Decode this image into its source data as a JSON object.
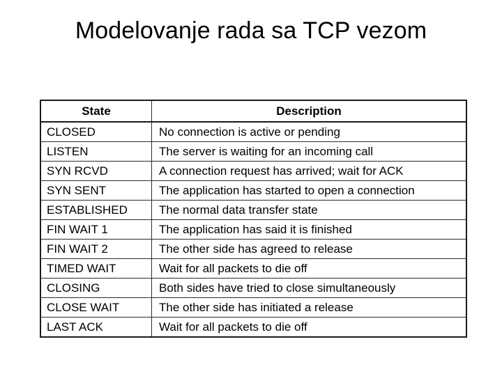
{
  "slide": {
    "title": "Modelovanje rada sa TCP vezom",
    "background_color": "#ffffff",
    "text_color": "#000000",
    "border_color": "#1a1a1a"
  },
  "table": {
    "columns": [
      {
        "key": "state",
        "header": "State"
      },
      {
        "key": "description",
        "header": "Description"
      }
    ],
    "rows": [
      {
        "state": "CLOSED",
        "description": "No connection is active or pending"
      },
      {
        "state": "LISTEN",
        "description": "The server is waiting for an incoming call"
      },
      {
        "state": "SYN RCVD",
        "description": "A connection request has arrived; wait for ACK"
      },
      {
        "state": "SYN SENT",
        "description": "The application has started to open a connection"
      },
      {
        "state": "ESTABLISHED",
        "description": "The normal data transfer state"
      },
      {
        "state": "FIN WAIT 1",
        "description": "The application has said it is finished"
      },
      {
        "state": "FIN WAIT 2",
        "description": "The other side has agreed to release"
      },
      {
        "state": "TIMED WAIT",
        "description": "Wait for all packets to die off"
      },
      {
        "state": "CLOSING",
        "description": "Both sides have tried to close simultaneously"
      },
      {
        "state": "CLOSE WAIT",
        "description": "The other side has initiated a release"
      },
      {
        "state": "LAST ACK",
        "description": "Wait for all packets to die off"
      }
    ]
  }
}
